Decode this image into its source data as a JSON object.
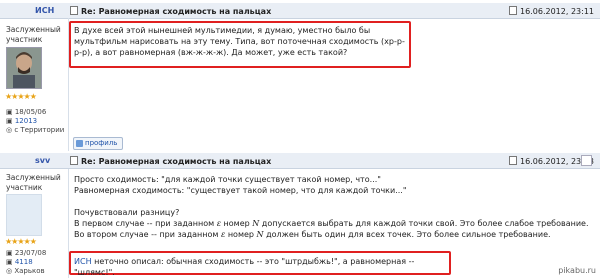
{
  "posts": [
    {
      "author": "ИСН",
      "title": "Re: Равномерная сходимость на пальцах",
      "date": "16.06.2012, 23:11",
      "rank": [
        "Заслуженный",
        "участник"
      ],
      "stars": "★★★★★",
      "reg_date": "18/05/06",
      "post_count": "12013",
      "location": "с Территории",
      "text": "В духе всей этой нынешней мультимедии, я думаю, уместно было бы мультфильм нарисовать на эту тему. Типа, вот поточечная сходимость (хр-р-р-р), а вот равномерная (вж-ж-ж-ж). Да может, уже есть такой?",
      "profile_label": "профиль"
    },
    {
      "author": "svv",
      "title": "Re: Равномерная сходимость на пальцах",
      "date": "16.06.2012, 23:23",
      "rank": [
        "Заслуженный",
        "участник"
      ],
      "stars": "★★★★★",
      "reg_date": "23/07/08",
      "post_count": "4118",
      "location": "Харьков",
      "lines": [
        "Просто сходимость: \"для каждой точки существует такой номер, что...\"",
        "Равномерная сходимость: \"существует такой номер, что для каждой точки...\"",
        "",
        "Почувствовали разницу?"
      ],
      "line_a_pre": "В первом случае -- при заданном",
      "line_a_mid": "номер",
      "line_a_post": "допускается выбрать для каждой точки свой. Это более слабое требование.",
      "line_b_pre": "Во втором случае -- при заданном",
      "line_b_mid": "номер",
      "line_b_post": "должен быть один для всех точек. Это более сильное требование.",
      "eps": "ε",
      "n_sym": "N",
      "quote_name": "ИСН",
      "quote_text": "неточно описал: обычная сходимость -- это \"штрдыбжь!\", а равномерная -- \"шлямс!\"."
    }
  ],
  "watermark": "pikabu.ru"
}
